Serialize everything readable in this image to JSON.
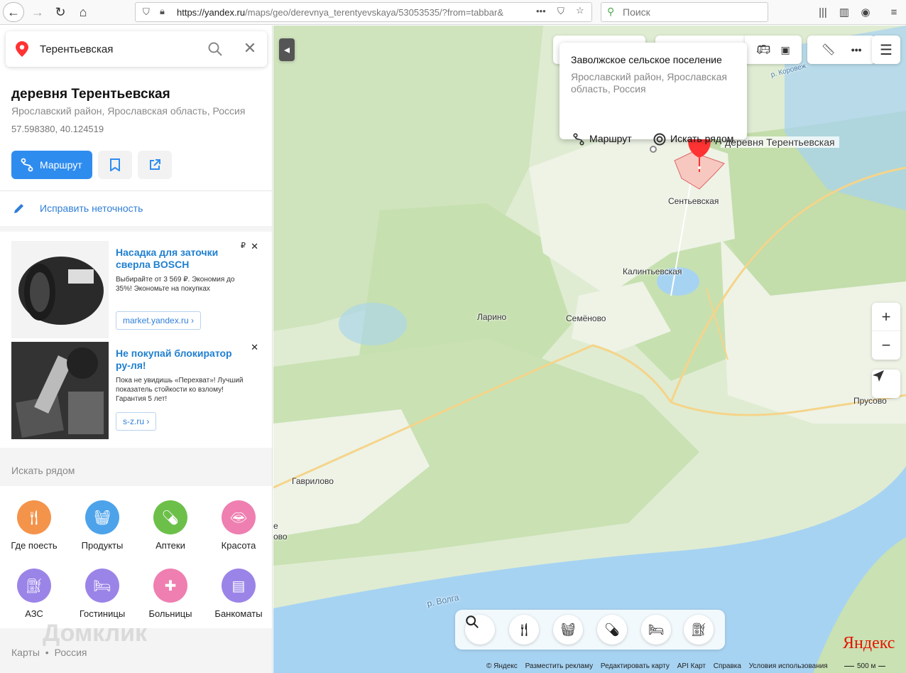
{
  "browser": {
    "url_main": "https://yandex.ru",
    "url_rest": "/maps/geo/derevnya_terentyevskaya/53053535/?from=tabbar&",
    "search_placeholder": "Поиск"
  },
  "sidebar": {
    "search_value": "Терентьевская",
    "title": "деревня Терентьевская",
    "subtitle": "Ярославский район, Ярославская область, Россия",
    "coords": "57.598380, 40.124519",
    "route_label": "Маршрут",
    "fix_label": "Исправить неточность",
    "ads": [
      {
        "title": "Насадка для заточки сверла BOSCH",
        "desc": "Выбирайте от 3 569 ₽. Экономия до 35%! Экономьте на покупках",
        "link": "market.yandex.ru ›",
        "rub": "₽"
      },
      {
        "title": "Не покупай блокиратор ру-ля!",
        "desc": "Пока не увидишь «Перехват»! Лучший показатель стойкости ко взлому! Гарантия 5 лет!",
        "link": "s-z.ru ›"
      }
    ],
    "nearby_title": "Искать рядом",
    "categories": [
      {
        "label": "Где поесть",
        "icon": "fork-knife-icon",
        "color": "#f4934a"
      },
      {
        "label": "Продукты",
        "icon": "basket-icon",
        "color": "#4da3ea"
      },
      {
        "label": "Аптеки",
        "icon": "pill-icon",
        "color": "#6cc04a"
      },
      {
        "label": "Красота",
        "icon": "lips-icon",
        "color": "#ef7fb0"
      },
      {
        "label": "АЗС",
        "icon": "fuel-icon",
        "color": "#9b84e8"
      },
      {
        "label": "Гостиницы",
        "icon": "bed-icon",
        "color": "#9b84e8"
      },
      {
        "label": "Больницы",
        "icon": "hospital-icon",
        "color": "#ef7fb0"
      },
      {
        "label": "Банкоматы",
        "icon": "atm-icon",
        "color": "#9b84e8"
      }
    ],
    "breadcrumb_1": "Карты",
    "breadcrumb_sep": "•",
    "breadcrumb_2": "Россия",
    "watermark": "Домклик"
  },
  "map": {
    "popup": {
      "title": "Заволжское сельское поселение",
      "subtitle": "Ярославский район, Ярославская область, Россия",
      "route": "Маршрут",
      "nearby": "Искать рядом"
    },
    "marker_label": "деревня Терентьевская",
    "labels": {
      "sentievskaya": "Сентьевская",
      "kalintievskaya": "Калинтьевская",
      "larino": "Ларино",
      "semenovo": "Семёново",
      "prusovo": "Прусово",
      "gavrilovo": "Гаврилово",
      "volga": "р. Волга",
      "korovezh": "р. Коровеж",
      "ovo_partial": "ово",
      "e_partial": "е"
    },
    "footer": [
      "© Яндекс",
      "Разместить рекламу",
      "Редактировать карту",
      "API Карт",
      "Справка",
      "Условия использования"
    ],
    "logo": "Яндекс",
    "scale": "500 м",
    "zoom_in": "+",
    "zoom_out": "−",
    "colors": {
      "water": "#a7d3f2",
      "forest": "#c9e2b4",
      "field": "#eef3e6",
      "road": "#f5d48a",
      "marker": "#f33"
    }
  }
}
